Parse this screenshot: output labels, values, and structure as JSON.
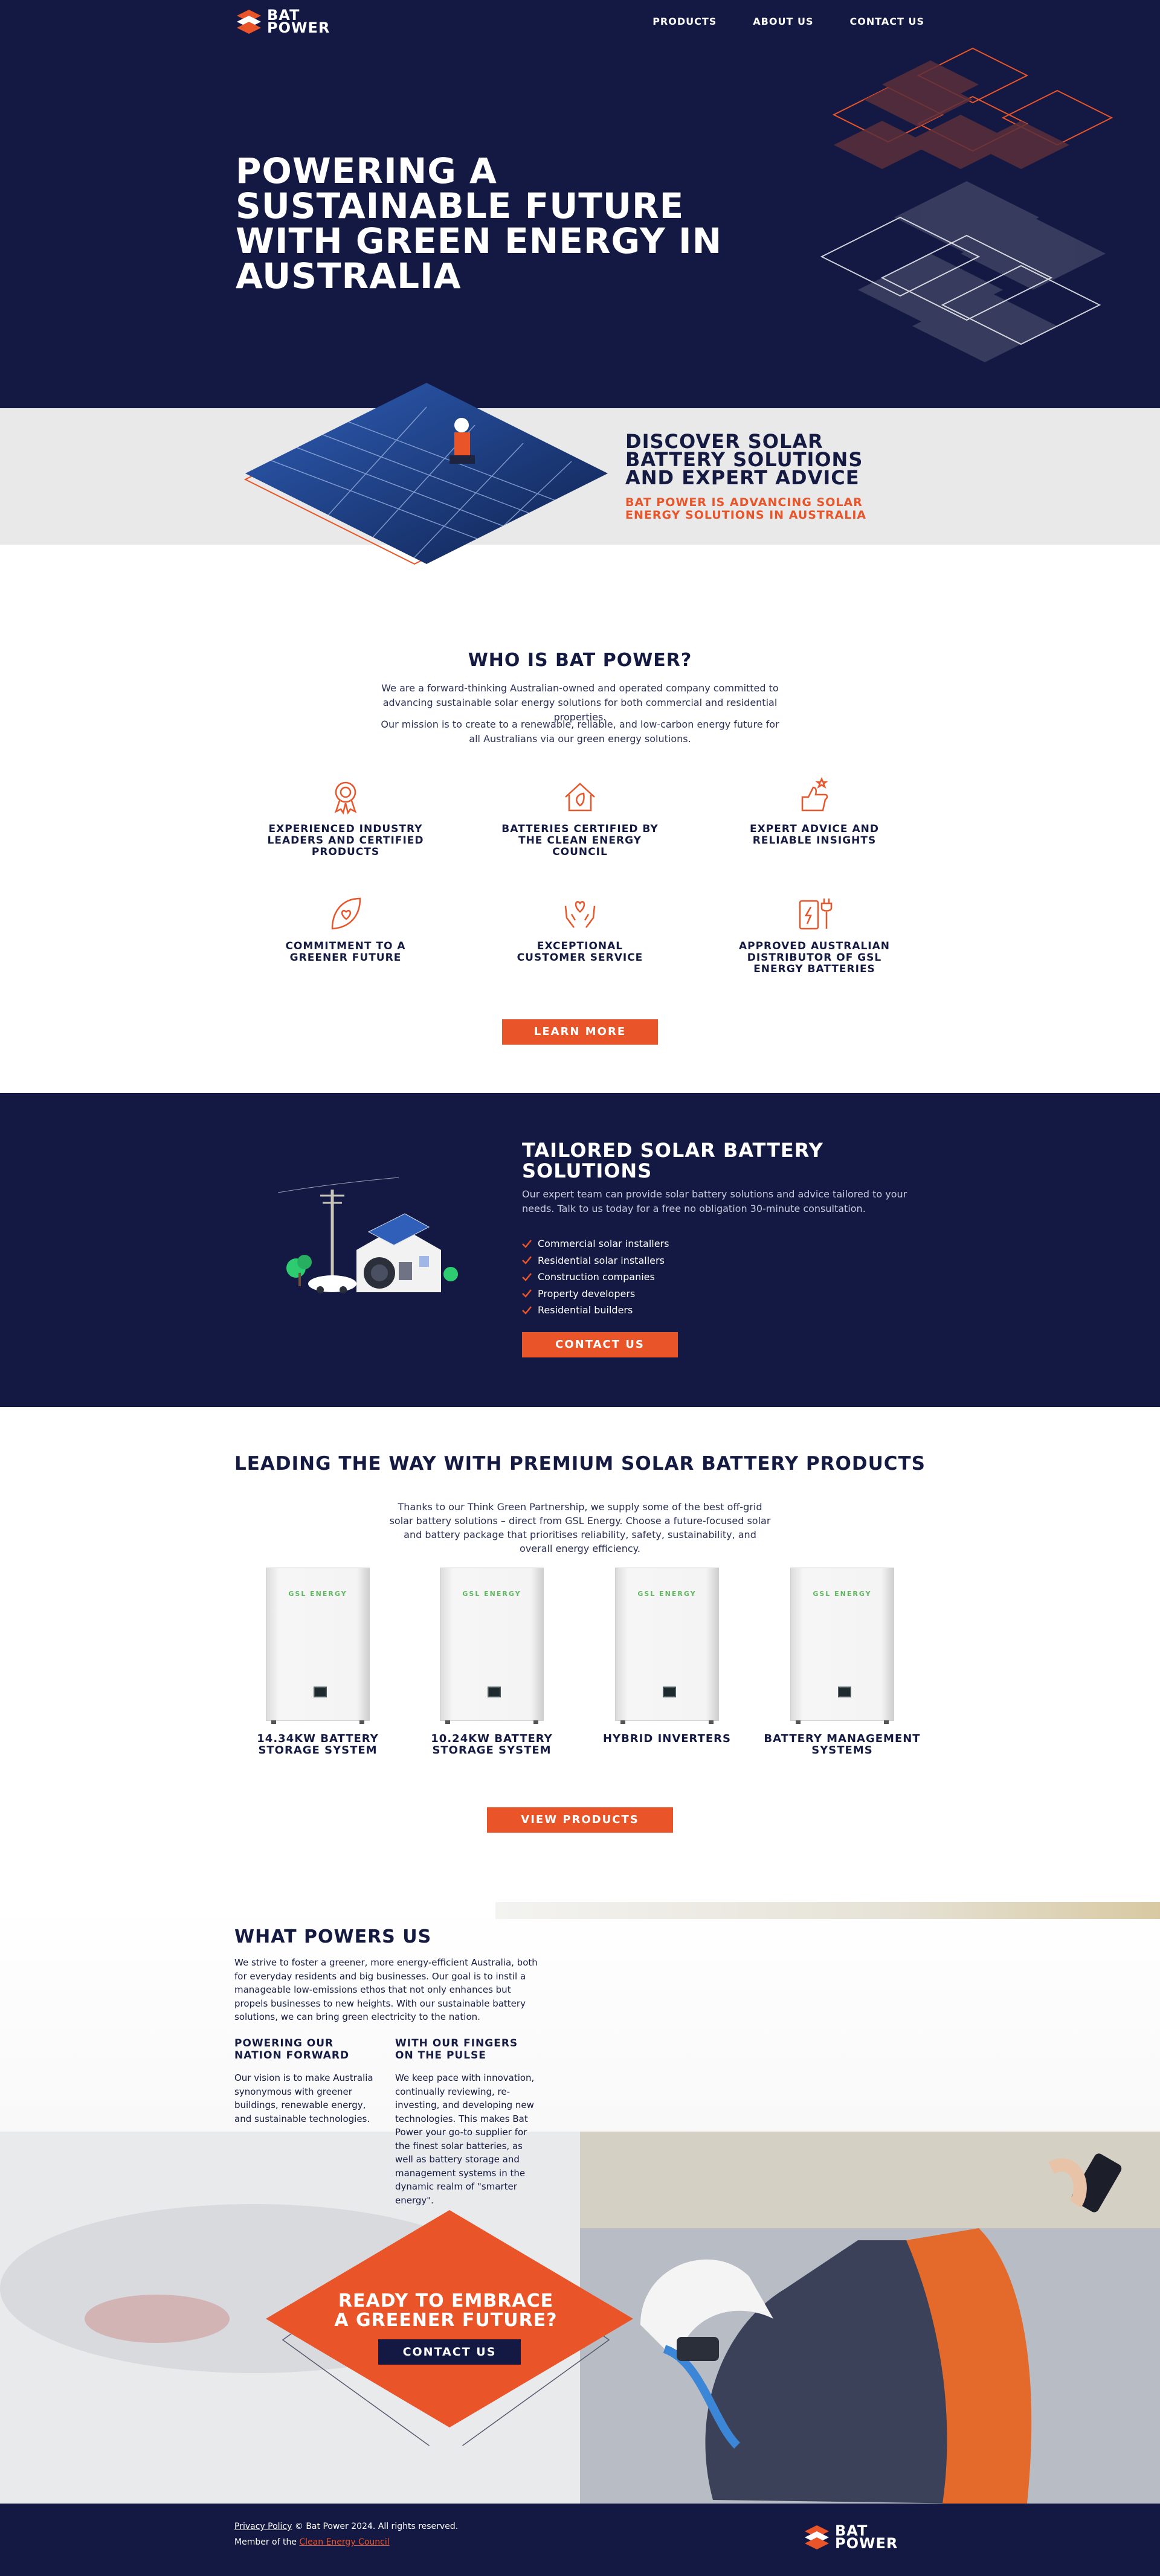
{
  "brand": {
    "name_line1": "BAT",
    "name_line2": "POWER"
  },
  "nav": {
    "items": [
      "PRODUCTS",
      "ABOUT US",
      "CONTACT US"
    ]
  },
  "hero": {
    "title": "POWERING A SUSTAINABLE FUTURE WITH GREEN ENERGY IN AUSTRALIA"
  },
  "discover": {
    "title": "DISCOVER SOLAR BATTERY SOLUTIONS AND EXPERT ADVICE",
    "subtitle": "BAT POWER IS ADVANCING SOLAR ENERGY SOLUTIONS IN AUSTRALIA"
  },
  "who": {
    "title": "WHO IS BAT POWER?",
    "para1": "We are a forward-thinking Australian-owned and operated company committed to advancing sustainable solar energy solutions for both commercial and residential properties.",
    "para2": "Our mission is to create to a renewable, reliable, and low-carbon energy future for all Australians via our green energy solutions.",
    "features": [
      {
        "label": "EXPERIENCED INDUSTRY LEADERS AND CERTIFIED PRODUCTS",
        "icon": "award-ribbon-icon"
      },
      {
        "label": "BATTERIES CERTIFIED BY THE CLEAN ENERGY COUNCIL",
        "icon": "eco-home-icon"
      },
      {
        "label": "EXPERT ADVICE AND RELIABLE INSIGHTS",
        "icon": "thumbs-up-stars-icon"
      },
      {
        "label": "COMMITMENT TO A GREENER FUTURE",
        "icon": "heart-leaf-icon"
      },
      {
        "label": "EXCEPTIONAL CUSTOMER SERVICE",
        "icon": "caring-hands-icon"
      },
      {
        "label": "APPROVED AUSTRALIAN DISTRIBUTOR OF GSL ENERGY BATTERIES",
        "icon": "battery-plug-icon"
      }
    ],
    "button": "LEARN MORE"
  },
  "tailored": {
    "title": "TAILORED SOLAR BATTERY SOLUTIONS",
    "description": "Our expert team can provide solar battery solutions and advice tailored to your needs. Talk to us today for a free no obligation 30-minute consultation.",
    "list": [
      "Commercial solar installers",
      "Residential solar installers",
      "Construction companies",
      "Property developers",
      "Residential builders"
    ],
    "button": "CONTACT US"
  },
  "products": {
    "title": "LEADING THE WAY WITH PREMIUM SOLAR BATTERY PRODUCTS",
    "description": "Thanks to our Think Green Partnership, we supply some of the best off-grid solar battery solutions – direct from GSL Energy. Choose a future-focused solar and battery package that prioritises reliability, safety, sustainability, and overall energy efficiency.",
    "battery_brand": "GSL ENERGY",
    "items": [
      "14.34KW BATTERY STORAGE SYSTEM",
      "10.24KW BATTERY STORAGE SYSTEM",
      "HYBRID INVERTERS",
      "BATTERY MANAGEMENT SYSTEMS"
    ],
    "button": "VIEW PRODUCTS"
  },
  "powers": {
    "title": "WHAT POWERS US",
    "para": "We strive to foster a greener, more energy-efficient Australia, both for everyday residents and big businesses. Our goal is to instil a manageable low-emissions ethos that not only enhances but propels businesses to new heights. With our sustainable battery solutions, we can bring green electricity to the nation.",
    "col1": {
      "title": "POWERING OUR NATION FORWARD",
      "text": "Our vision is to make Australia synonymous with greener buildings, renewable energy, and sustainable technologies."
    },
    "col2": {
      "title": "WITH OUR FINGERS ON THE PULSE",
      "text": "We keep pace with innovation, continually reviewing, re-investing, and developing new technologies. This makes Bat Power your go-to supplier for the finest solar batteries, as well as battery storage and management systems in the dynamic realm of \"smarter energy\"."
    }
  },
  "cta": {
    "title": "READY TO EMBRACE A GREENER FUTURE?",
    "button": "CONTACT US"
  },
  "footer": {
    "privacy": "Privacy Policy",
    "copyright": " © Bat Power 2024. All rights reserved.",
    "member_prefix": "Member of the ",
    "member_link": "Clean Energy Council"
  },
  "colors": {
    "navy": "#131943",
    "orange": "#e95428",
    "light_gray": "#e9e9e9"
  }
}
